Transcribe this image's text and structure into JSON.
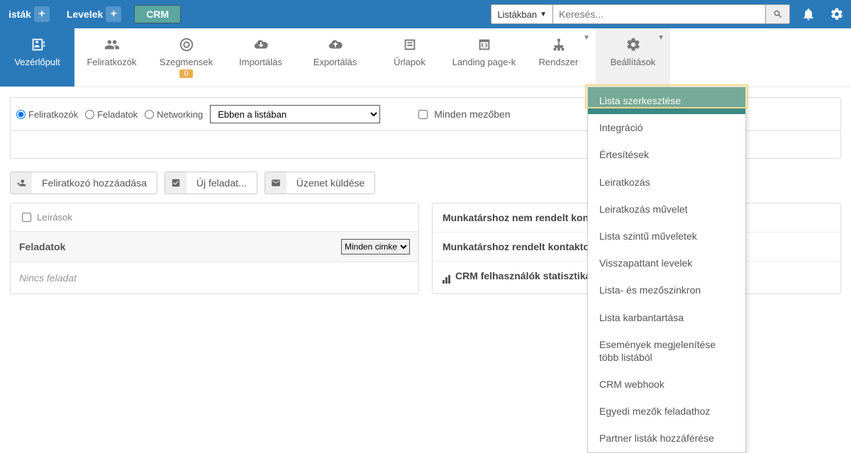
{
  "topnav": {
    "lists": "isták",
    "emails": "Levelek",
    "crm": "CRM"
  },
  "search": {
    "scope": "Listákban",
    "placeholder": "Keresés..."
  },
  "tabs": {
    "dashboard": "Vezérlőpult",
    "subscribers": "Feliratkozók",
    "segments": "Szegmensek",
    "segments_badge": "0",
    "import": "Importálás",
    "export": "Exportálás",
    "forms": "Űrlapok",
    "landing": "Landing page-k",
    "system": "Rendszer",
    "settings": "Beállítások"
  },
  "filters": {
    "radio1": "Feliratkozók",
    "radio2": "Feladatok",
    "radio3": "Networking",
    "list_scope": "Ebben a listában",
    "all_fields": "Minden mezőben"
  },
  "actions": {
    "add_subscriber": "Feliratkozó hozzáadása",
    "new_task": "Új feladat...",
    "send_message": "Üzenet küldése"
  },
  "left_panel": {
    "descriptions": "Leírások",
    "tasks_header": "Feladatok",
    "tag_filter": "Minden cimke",
    "no_task": "Nincs feladat"
  },
  "right_panel": {
    "row1": "Munkatárshoz nem rendelt kontaktok",
    "row2": "Munkatárshoz rendelt kontaktok",
    "row3": "CRM felhasználók statisztikái"
  },
  "settings_menu": {
    "items": [
      "Lista szerkesztése",
      "Integráció",
      "Értesítések",
      "Leiratkozás",
      "Leiratkozás művelet",
      "Lista szintű műveletek",
      "Visszapattant levelek",
      "Lista- és mezőszinkron",
      "Lista karbantartása",
      "Események megjelenítése több listából",
      "CRM webhook",
      "Egyedi mezők feladathoz",
      "Partner listák hozzáférése"
    ]
  }
}
